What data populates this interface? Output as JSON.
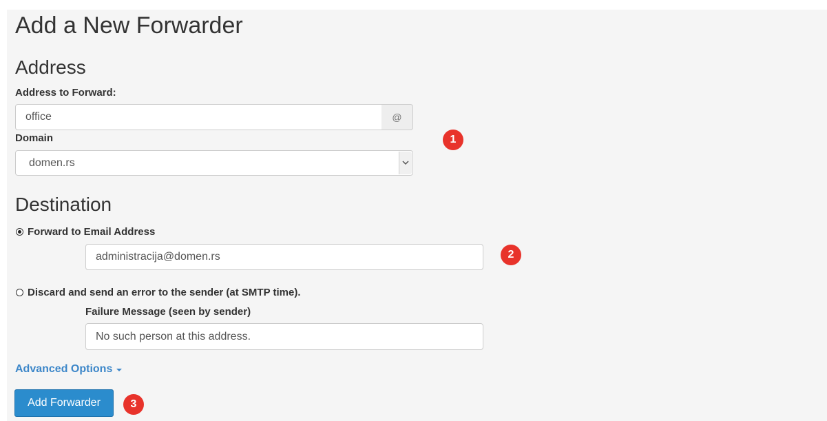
{
  "page": {
    "title": "Add a New Forwarder"
  },
  "address": {
    "heading": "Address",
    "forward_label": "Address to Forward:",
    "forward_value": "office",
    "at_symbol": "@",
    "domain_label": "Domain",
    "domain_selected": "domen.rs"
  },
  "destination": {
    "heading": "Destination",
    "forward_option_label": "Forward to Email Address",
    "forward_option_selected": true,
    "forward_email_value": "administracija@domen.rs",
    "discard_option_label": "Discard and send an error to the sender (at SMTP time).",
    "discard_option_selected": false,
    "failure_label": "Failure Message (seen by sender)",
    "failure_value": "No such person at this address."
  },
  "advanced_options_label": "Advanced Options",
  "submit_label": "Add Forwarder",
  "annotations": {
    "step1": "1",
    "step2": "2",
    "step3": "3",
    "color": "#e8332b"
  },
  "colors": {
    "panel_bg": "#f5f5f5",
    "link": "#3d87c9",
    "button_bg": "#2b8ccd"
  },
  "icons": {
    "select_arrow": "chevron-down-icon",
    "caret": "caret-down-icon"
  }
}
